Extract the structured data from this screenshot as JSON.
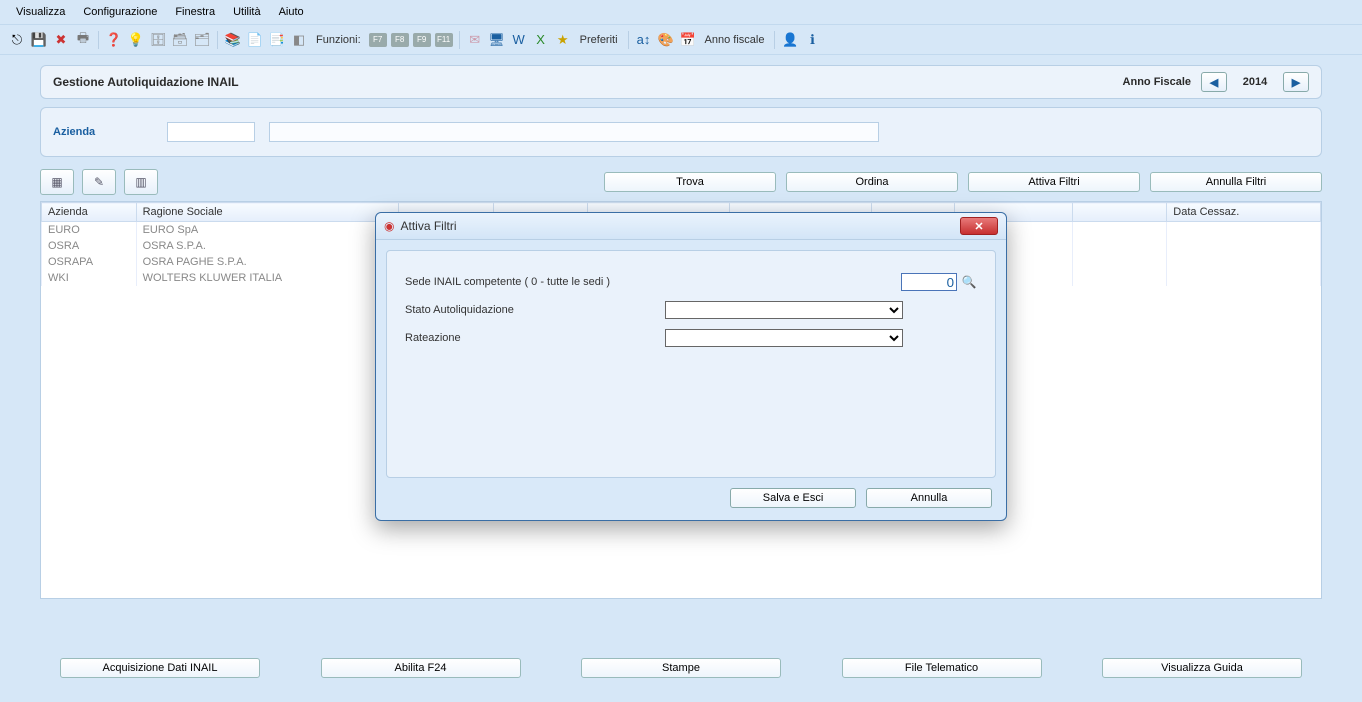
{
  "menu": {
    "items": [
      "Visualizza",
      "Configurazione",
      "Finestra",
      "Utilità",
      "Aiuto"
    ]
  },
  "toolbar": {
    "funzioni_label": "Funzioni:",
    "fkeys": [
      "F7",
      "F8",
      "F9",
      "F11"
    ],
    "preferiti_label": "Preferiti",
    "annofiscale_label": "Anno fiscale"
  },
  "titlebar": {
    "title": "Gestione Autoliquidazione INAIL",
    "anno_label": "Anno Fiscale",
    "anno_value": "2014"
  },
  "panel": {
    "azienda_label": "Azienda"
  },
  "actions": {
    "trova": "Trova",
    "ordina": "Ordina",
    "attiva": "Attiva Filtri",
    "annulla": "Annulla Filtri"
  },
  "table": {
    "columns": [
      "Azienda",
      "Ragione Sociale",
      "",
      "",
      "",
      "",
      "",
      "",
      "",
      "Data Cessaz."
    ],
    "rows": [
      {
        "az": "EURO",
        "rs": "EURO SpA"
      },
      {
        "az": "OSRA",
        "rs": "OSRA S.P.A."
      },
      {
        "az": "OSRAPA",
        "rs": "OSRA PAGHE S.P.A."
      },
      {
        "az": "WKI",
        "rs": "WOLTERS KLUWER ITALIA"
      }
    ]
  },
  "bottom": {
    "b1": "Acquisizione Dati INAIL",
    "b2": "Abilita F24",
    "b3": "Stampe",
    "b4": "File Telematico",
    "b5": "Visualizza Guida"
  },
  "dialog": {
    "title": "Attiva Filtri",
    "sede_label": "Sede INAIL competente ( 0 - tutte le sedi )",
    "sede_value": "0",
    "stato_label": "Stato Autoliquidazione",
    "rate_label": "Rateazione",
    "save": "Salva e Esci",
    "cancel": "Annulla"
  }
}
